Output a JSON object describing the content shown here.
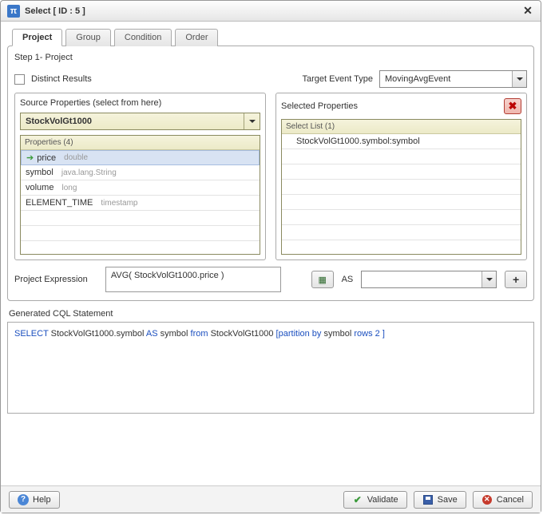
{
  "dialog": {
    "title": "Select [ ID : 5 ]"
  },
  "tabs": {
    "items": [
      {
        "label": "Project",
        "active": true
      },
      {
        "label": "Group",
        "active": false
      },
      {
        "label": "Condition",
        "active": false
      },
      {
        "label": "Order",
        "active": false
      }
    ]
  },
  "step": {
    "label": "Step 1- Project"
  },
  "distinct": {
    "label": "Distinct Results",
    "checked": false
  },
  "target": {
    "label": "Target Event Type",
    "value": "MovingAvgEvent"
  },
  "source_panel": {
    "title": "Source Properties (select from here)",
    "source_value": "StockVolGt1000",
    "list_header": "Properties (4)",
    "rows": [
      {
        "name": "price",
        "type": "double",
        "selected": true
      },
      {
        "name": "symbol",
        "type": "java.lang.String",
        "selected": false
      },
      {
        "name": "volume",
        "type": "long",
        "selected": false
      },
      {
        "name": "ELEMENT_TIME",
        "type": "timestamp",
        "selected": false
      }
    ]
  },
  "selected_panel": {
    "title": "Selected Properties",
    "list_header": "Select List (1)",
    "rows": [
      {
        "label": "StockVolGt1000.symbol:symbol"
      }
    ]
  },
  "expression": {
    "label": "Project Expression",
    "value": "AVG( StockVolGt1000.price )",
    "as_label": "AS",
    "as_value": ""
  },
  "generated": {
    "label": "Generated CQL Statement",
    "tokens": [
      {
        "t": "SELECT ",
        "c": "kw"
      },
      {
        "t": "StockVolGt1000.symbol ",
        "c": "txt"
      },
      {
        "t": "AS ",
        "c": "kw"
      },
      {
        "t": "symbol ",
        "c": "txt"
      },
      {
        "t": "from  ",
        "c": "kw"
      },
      {
        "t": "StockVolGt1000  ",
        "c": "txt"
      },
      {
        "t": "[",
        "c": "br"
      },
      {
        "t": "partition by  ",
        "c": "kw"
      },
      {
        "t": "symbol  ",
        "c": "txt"
      },
      {
        "t": "rows 2 ",
        "c": "kw"
      },
      {
        "t": "]",
        "c": "br"
      }
    ]
  },
  "footer": {
    "help": "Help",
    "validate": "Validate",
    "save": "Save",
    "cancel": "Cancel"
  }
}
